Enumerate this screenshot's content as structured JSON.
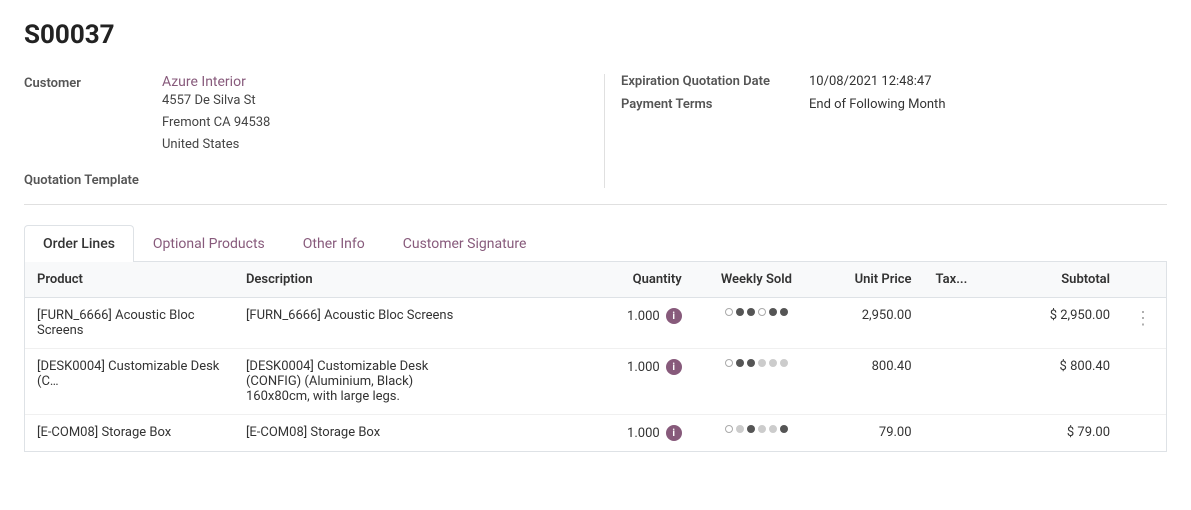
{
  "page": {
    "title": "S00037"
  },
  "form": {
    "customer_label": "Customer",
    "customer_name": "Azure Interior",
    "customer_address_line1": "4557 De Silva St",
    "customer_address_line2": "Fremont CA 94538",
    "customer_address_line3": "United States",
    "quotation_template_label": "Quotation Template",
    "expiration_label": "Expiration Quotation Date",
    "expiration_value": "10/08/2021 12:48:47",
    "payment_terms_label": "Payment Terms",
    "payment_terms_value": "End of Following Month"
  },
  "tabs": [
    {
      "id": "order-lines",
      "label": "Order Lines",
      "active": true
    },
    {
      "id": "optional-products",
      "label": "Optional Products",
      "active": false
    },
    {
      "id": "other-info",
      "label": "Other Info",
      "active": false
    },
    {
      "id": "customer-signature",
      "label": "Customer Signature",
      "active": false
    }
  ],
  "table": {
    "headers": [
      {
        "id": "product",
        "label": "Product"
      },
      {
        "id": "description",
        "label": "Description"
      },
      {
        "id": "quantity",
        "label": "Quantity"
      },
      {
        "id": "weekly-sold",
        "label": "Weekly Sold"
      },
      {
        "id": "unit-price",
        "label": "Unit Price"
      },
      {
        "id": "tax",
        "label": "Tax..."
      },
      {
        "id": "subtotal",
        "label": "Subtotal"
      },
      {
        "id": "more",
        "label": ""
      }
    ],
    "rows": [
      {
        "product": "[FURN_6666] Acoustic Bloc Screens",
        "description": "[FURN_6666] Acoustic Bloc Screens",
        "quantity": "1.000",
        "dots": [
          0,
          1,
          1,
          1,
          0,
          1,
          1
        ],
        "unit_price": "2,950.00",
        "tax": "",
        "subtotal": "$ 2,950.00"
      },
      {
        "product": "[DESK0004] Customizable Desk (C…",
        "description_line1": "[DESK0004] Customizable Desk",
        "description_line2": "(CONFIG) (Aluminium, Black)",
        "description_line3": "160x80cm, with large legs.",
        "quantity": "1.000",
        "dots": [
          0,
          1,
          1,
          0,
          0,
          0,
          0
        ],
        "unit_price": "800.40",
        "tax": "",
        "subtotal": "$ 800.40"
      },
      {
        "product": "[E-COM08] Storage Box",
        "description": "[E-COM08] Storage Box",
        "quantity": "1.000",
        "dots": [
          0,
          0,
          1,
          0,
          0,
          1,
          0
        ],
        "unit_price": "79.00",
        "tax": "",
        "subtotal": "$ 79.00"
      }
    ]
  }
}
